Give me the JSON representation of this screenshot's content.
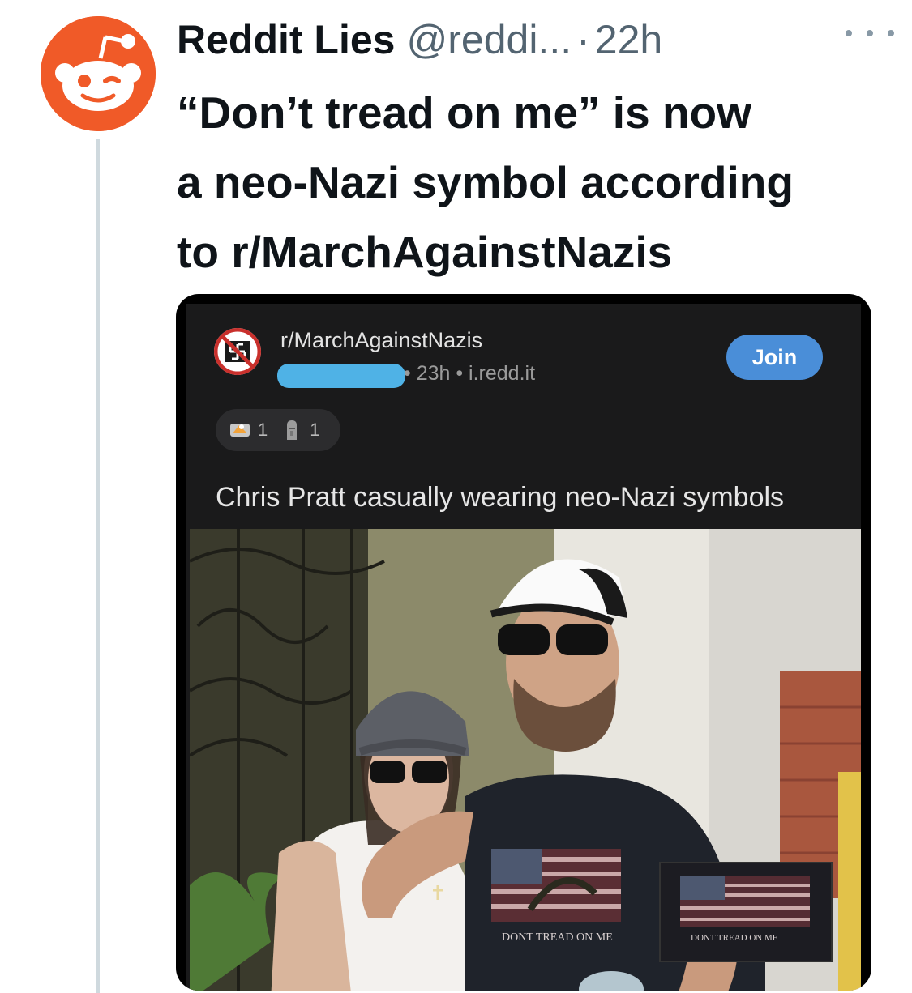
{
  "tweet": {
    "display_name": "Reddit Lies",
    "handle": "@reddi...",
    "separator": "·",
    "age": "22h",
    "text_lines": [
      "“Don’t tread on me” is now",
      "a neo-Nazi symbol according",
      "to r/MarchAgainstNazis"
    ]
  },
  "reddit_post": {
    "subreddit": "r/MarchAgainstNazis",
    "meta": "• 23h • i.redd.it",
    "join_label": "Join",
    "awards": [
      {
        "icon": "eagle-award-icon",
        "count": "1"
      },
      {
        "icon": "moai-award-icon",
        "count": "1"
      }
    ],
    "title": "Chris Pratt casually wearing neo-Nazi symbols",
    "shirt_text": "DONT TREAD ON ME",
    "inset_shirt_text": "DONT TREAD ON ME"
  },
  "colors": {
    "reddit_orange": "#f05a28",
    "join_blue": "#4a8ed8",
    "redaction_blue": "#4fb2e6"
  }
}
